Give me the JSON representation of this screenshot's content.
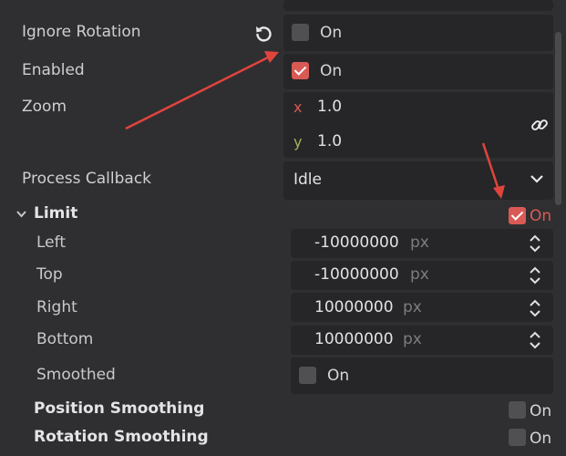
{
  "properties": {
    "ignore_rotation": {
      "label": "Ignore Rotation",
      "checked": false,
      "value_label": "On"
    },
    "enabled": {
      "label": "Enabled",
      "checked": true,
      "value_label": "On"
    },
    "zoom": {
      "label": "Zoom",
      "x_axis": "x",
      "x_value": "1.0",
      "y_axis": "y",
      "y_value": "1.0"
    },
    "process_callback": {
      "label": "Process Callback",
      "value": "Idle"
    },
    "limit": {
      "label": "Limit",
      "checked": true,
      "value_label": "On",
      "left": {
        "label": "Left",
        "value": "-10000000",
        "unit": "px"
      },
      "top": {
        "label": "Top",
        "value": "-10000000",
        "unit": "px"
      },
      "right": {
        "label": "Right",
        "value": "10000000",
        "unit": "px"
      },
      "bottom": {
        "label": "Bottom",
        "value": "10000000",
        "unit": "px"
      },
      "smoothed": {
        "label": "Smoothed",
        "checked": false,
        "value_label": "On"
      }
    },
    "position_smoothing": {
      "label": "Position Smoothing",
      "checked": false,
      "value_label": "On"
    },
    "rotation_smoothing": {
      "label": "Rotation Smoothing",
      "checked": false,
      "value_label": "On"
    }
  },
  "icons": {
    "revert": "revert-icon",
    "link": "link-icon",
    "chevron": "chevron-down-icon",
    "collapse": "collapse-arrow-icon",
    "spinner": "spinner-arrows-icon"
  },
  "colors": {
    "accent": "#d95a55",
    "background": "#2f2f31",
    "field": "#262628",
    "axis_y": "#a5b35a"
  }
}
